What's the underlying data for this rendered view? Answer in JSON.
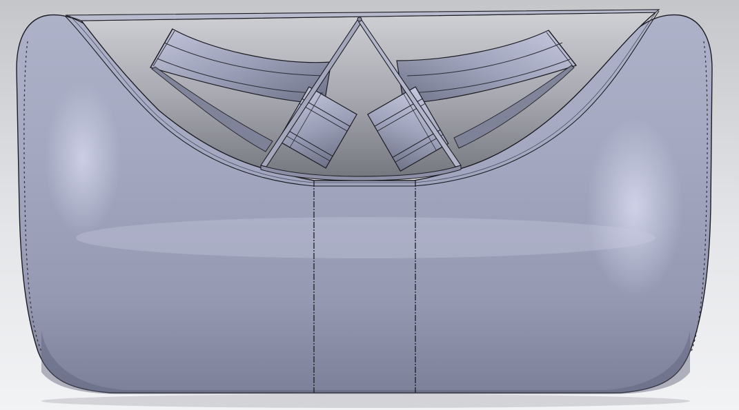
{
  "viewport": {
    "background_top": "#c4c6ca",
    "background_mid": "#e4e5e8",
    "background_bottom": "#f2f3f5"
  },
  "model": {
    "description_hidden": "",
    "colors": {
      "body_light": "#c3c7dd",
      "body_mid": "#9ea3bb",
      "body_dark": "#70748c",
      "cavity_dark": "#6f7282",
      "cavity_light": "#d0d1d6",
      "edge_line": "#1b1c22",
      "highlight": "#d6d9ec"
    }
  }
}
